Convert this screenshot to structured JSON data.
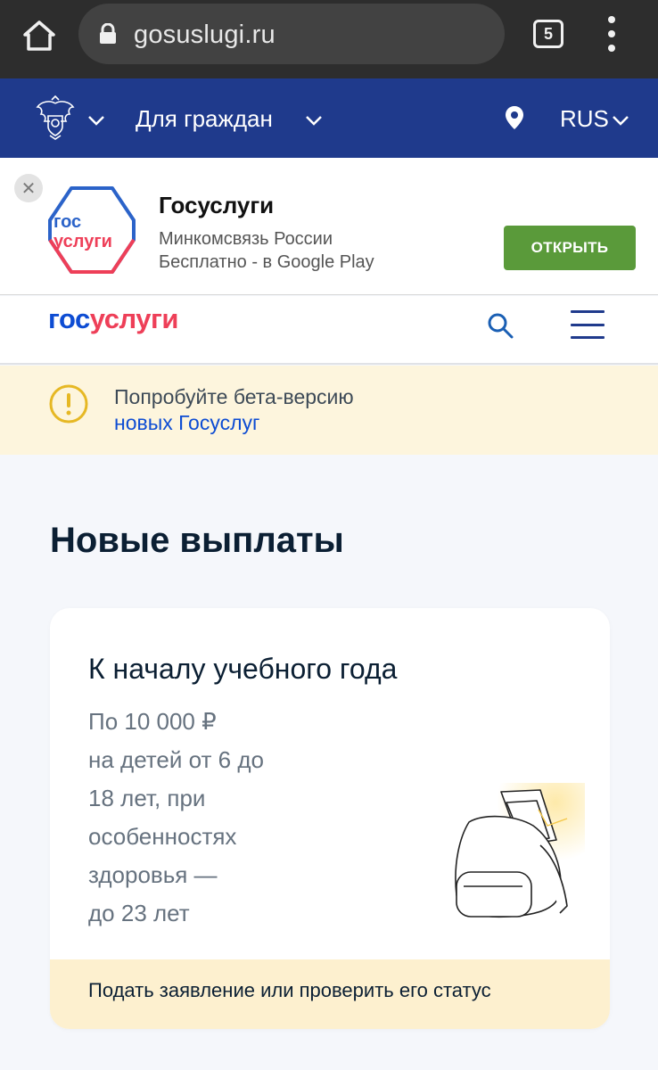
{
  "browser": {
    "url": "gosuslugi.ru",
    "tab_count": "5"
  },
  "top_nav": {
    "audience": "Для граждан",
    "language": "RUS"
  },
  "app_banner": {
    "name": "Госуслуги",
    "developer": "Минкомсвязь России",
    "price": "Бесплатно - в Google Play",
    "open_label": "ОТКРЫТЬ",
    "logo_line1": "гос",
    "logo_line2": "услуги"
  },
  "site_header": {
    "logo_part1": "гос",
    "logo_part2": "услуги"
  },
  "beta_notice": {
    "text": "Попробуйте бета-версию",
    "link": "новых Госуслуг"
  },
  "section": {
    "title": "Новые выплаты",
    "card": {
      "title": "К началу учебного года",
      "desc_lines": [
        "По 10 000 ₽",
        "на детей от 6 до",
        "18 лет, при",
        "особенностях",
        "здоровья —",
        "до 23 лет"
      ],
      "action": "Подать заявление или проверить его статус"
    }
  },
  "colors": {
    "nav_blue": "#1f3a8c",
    "brand_blue": "#0d4cd3",
    "brand_red": "#ee3f58",
    "open_green": "#5a9a3a",
    "beta_bg": "#fdf5dd",
    "card_footer_bg": "#fdf0cf"
  }
}
